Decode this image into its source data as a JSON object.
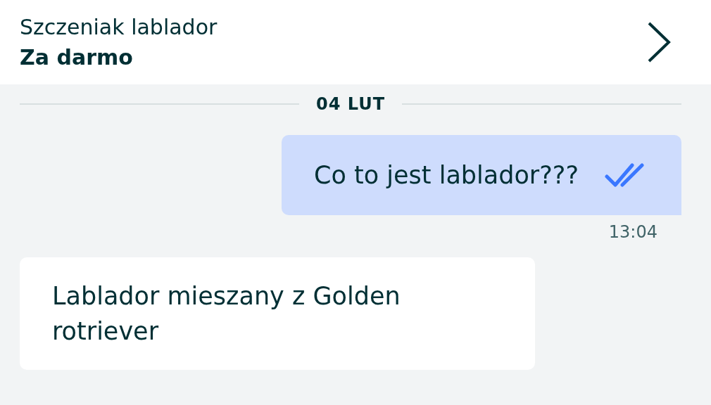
{
  "header": {
    "title": "Szczeniak lablador",
    "price": "Za darmo"
  },
  "date_separator": "04 LUT",
  "messages": [
    {
      "kind": "outgoing",
      "text": "Co to jest lablador???",
      "read": true,
      "time": "13:04"
    },
    {
      "kind": "incoming",
      "text": "Lablador mieszany z Golden rotriever"
    }
  ]
}
